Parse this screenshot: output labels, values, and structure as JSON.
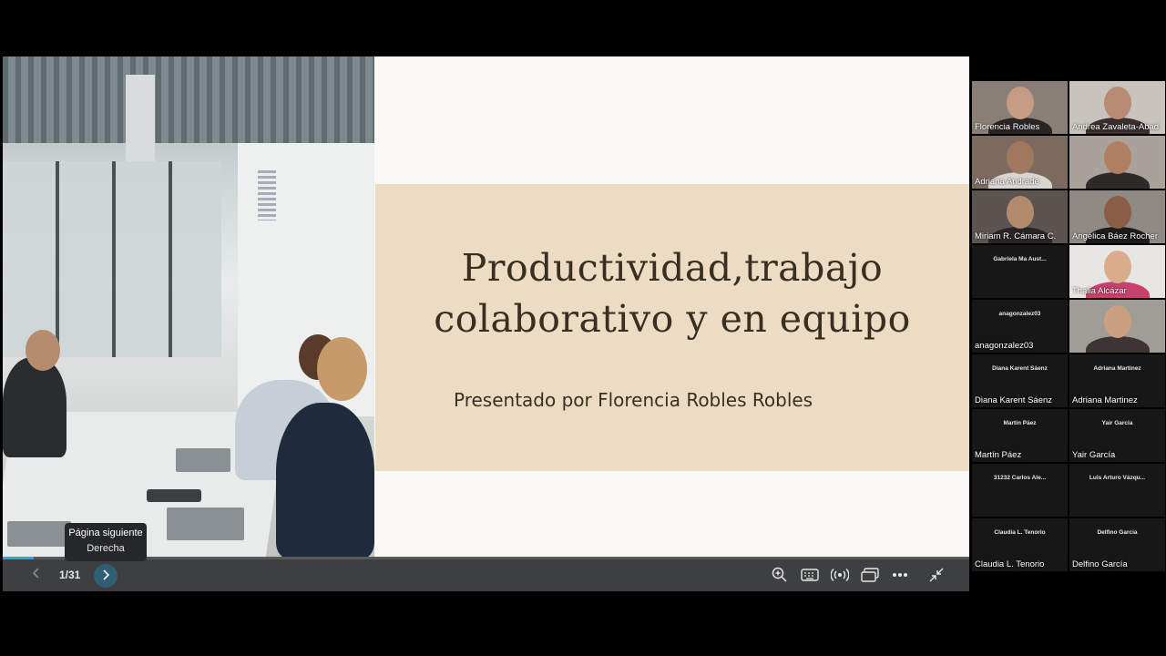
{
  "slide": {
    "title_line1": "Productividad,trabajo",
    "title_line2": "colaborativo y en equipo",
    "subtitle": "Presentado por Florencia Robles Robles"
  },
  "viewer": {
    "page_counter": "1/31",
    "progress_fraction": 0.032,
    "tooltip_line1": "Página siguiente",
    "tooltip_line2": "Derecha",
    "prev_icon": "chevron-left-icon",
    "next_icon": "chevron-right-icon",
    "toolbar_icons": [
      "zoom-in-icon",
      "keyboard-icon",
      "broadcast-icon",
      "screen-share-icon",
      "more-options-icon",
      "exit-fullscreen-icon"
    ]
  },
  "participants": [
    {
      "name": "Florencia Robles",
      "video": true
    },
    {
      "name": "Andrea Zavaleta-Abad",
      "video": true
    },
    {
      "name": "Adriana Andrade",
      "video": true
    },
    {
      "name": "",
      "video": true
    },
    {
      "name": "Miriam R. Cámara C.",
      "video": true
    },
    {
      "name": "Angélica Báez Rocher",
      "video": true
    },
    {
      "name": "",
      "center_label": "Gabriela Ma Aust...",
      "video": false
    },
    {
      "name": "Thalia Alcázar",
      "video": true
    },
    {
      "name": "anagonzalez03",
      "center_label": "anagonzalez03",
      "video": false
    },
    {
      "name": "",
      "video": true
    },
    {
      "name": "Diana Karent Sáenz",
      "center_label": "Diana Karent Sáenz",
      "video": false
    },
    {
      "name": "Adriana Martinez",
      "center_label": "Adriana Martinez",
      "video": false
    },
    {
      "name": "Martín Páez",
      "center_label": "Martín Páez",
      "video": false
    },
    {
      "name": "Yair García",
      "center_label": "Yair Garcia",
      "video": false
    },
    {
      "name": "",
      "center_label": "31232 Carlos Ale...",
      "video": false
    },
    {
      "name": "",
      "center_label": "Luis Arturo Vázqu...",
      "video": false
    },
    {
      "name": "Claudia L. Tenorio",
      "center_label": "Claudia L. Tenorio",
      "video": false
    },
    {
      "name": "Delfino García",
      "center_label": "Delfino Garcia",
      "video": false
    }
  ]
}
